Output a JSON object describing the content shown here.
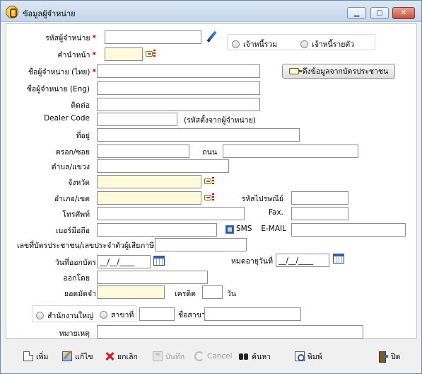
{
  "window": {
    "title": "ข้อมูลผู้จำหน่าย",
    "minimize": "▁",
    "maximize": "▢",
    "close": "✕"
  },
  "form": {
    "vendor_code": {
      "label": "รหัสผู้จำหน่าย",
      "required": "*",
      "value": ""
    },
    "prefix": {
      "label": "คำนำหน้า",
      "required": "*",
      "value": ""
    },
    "name_th": {
      "label": "ชื่อผู้จำหน่าย (ไทย)",
      "required": "*",
      "value": ""
    },
    "name_en": {
      "label": "ชื่อผู้จำหน่าย (Eng)",
      "value": ""
    },
    "contact": {
      "label": "ติดต่อ",
      "value": ""
    },
    "dealer_code": {
      "label": "Dealer Code",
      "value": "",
      "hint": "(รหัสตั้งจากผู้จำหน่าย)"
    },
    "address": {
      "label": "ที่อยู่",
      "value": ""
    },
    "lane": {
      "label": "ตรอก/ซอย",
      "value": ""
    },
    "road": {
      "label": "ถนน",
      "value": ""
    },
    "subdistrict": {
      "label": "ตำบล/แขวง",
      "value": ""
    },
    "province": {
      "label": "จังหวัด",
      "value": ""
    },
    "district": {
      "label": "อำเภอ/เขต",
      "value": ""
    },
    "postcode": {
      "label": "รหัสไปรษณีย์",
      "value": ""
    },
    "phone": {
      "label": "โทรศัพท์",
      "value": ""
    },
    "fax": {
      "label": "Fax.",
      "value": ""
    },
    "mobile": {
      "label": "เบอร์มือถือ",
      "value": ""
    },
    "sms": {
      "label": "SMS"
    },
    "email": {
      "label": "E-MAIL",
      "value": ""
    },
    "id_card": {
      "label": "เลขที่บัตรประชาชน/เลขประจำตัวผู้เสียภาษี",
      "value": ""
    },
    "issue_date": {
      "label": "วันที่ออกบัตร",
      "value": "__/__/____"
    },
    "expire_date": {
      "label": "หมดอายุวันที่",
      "value": "__/__/____"
    },
    "issued_by": {
      "label": "ออกโดย",
      "value": ""
    },
    "balance": {
      "label": "ยอดมัดจำ",
      "value": ""
    },
    "credit": {
      "label": "เครดิต",
      "value": "",
      "unit": "วัน"
    },
    "branch_no": {
      "label": "สาขาที่",
      "value": ""
    },
    "branch_name": {
      "label": "ชื่อสาขา",
      "value": ""
    },
    "note": {
      "label": "หมายเหตุ",
      "value": ""
    }
  },
  "debtor_type": {
    "option_combined": "เจ้าหนี้รวม",
    "option_individual": "เจ้าหนี้รายตัว"
  },
  "branch_type": {
    "option_head": "สำนักงานใหญ่",
    "option_branch": "สาขาที่"
  },
  "id_card_button": "ดึงข้อมูลจากบัตรประชาชน",
  "toolbar": {
    "add": "เพิ่ม",
    "edit": "แก้ไข",
    "cancel_record": "ยกเลิก",
    "save": "บันทึก",
    "cancel": "Cancel",
    "search": "ค้นหา",
    "print": "พิมพ์",
    "close": "ปิด"
  },
  "colors": {
    "required": "#d40000",
    "lookup_field": "#fdfbdb"
  }
}
